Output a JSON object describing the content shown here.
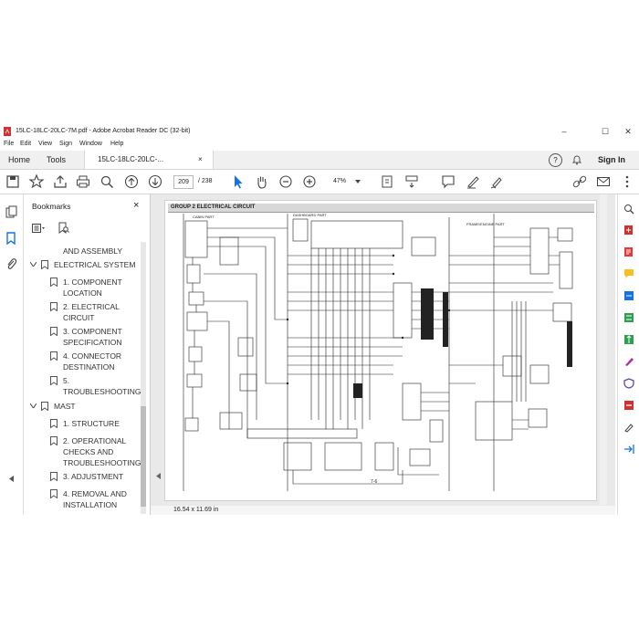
{
  "window": {
    "title": "15LC-18LC-20LC-7M.pdf - Adobe Acrobat Reader DC (32-bit)",
    "controls": {
      "minimize": "–",
      "maximize": "☐",
      "close": "✕"
    }
  },
  "menu": [
    "File",
    "Edit",
    "View",
    "Sign",
    "Window",
    "Help"
  ],
  "tabs": {
    "home": "Home",
    "tools": "Tools",
    "document": "15LC-18LC-20LC-...",
    "doc_close": "×"
  },
  "right_header": {
    "help": "?",
    "signin": "Sign In"
  },
  "toolbar": {
    "page_current": "209",
    "page_total": "/ 238",
    "zoom": "47%"
  },
  "bookmarks": {
    "header": "Bookmarks",
    "close": "×",
    "items": [
      {
        "label": "AND ASSEMBLY"
      },
      {
        "label": "ELECTRICAL SYSTEM"
      },
      {
        "label": "1. COMPONENT"
      },
      {
        "label": "LOCATION"
      },
      {
        "label": "2. ELECTRICAL"
      },
      {
        "label": "CIRCUIT"
      },
      {
        "label": "3. COMPONENT"
      },
      {
        "label": "SPECIFICATION"
      },
      {
        "label": "4. CONNECTOR"
      },
      {
        "label": "DESTINATION"
      },
      {
        "label": "5."
      },
      {
        "label": "TROUBLESHOOTING"
      },
      {
        "label": "MAST"
      },
      {
        "label": "1. STRUCTURE"
      },
      {
        "label": "2. OPERATIONAL"
      },
      {
        "label": "CHECKS AND"
      },
      {
        "label": "TROUBLESHOOTING"
      },
      {
        "label": "3. ADJUSTMENT"
      },
      {
        "label": "4. REMOVAL AND"
      },
      {
        "label": "INSTALLATION"
      }
    ]
  },
  "page": {
    "group_header": "GROUP 2 ELECTRICAL CIRCUIT",
    "section_cabin": "CABIN PART",
    "section_dashboard": "DASHBOARD PART",
    "section_frame": "FRAME/ENGINE PART",
    "page_number": "7-6"
  },
  "status": {
    "page_size": "16.54 x 11.69 in"
  },
  "colors": {
    "accent": "#1473e6",
    "pdf_red": "#d32f2f",
    "schematic": "#222222"
  }
}
